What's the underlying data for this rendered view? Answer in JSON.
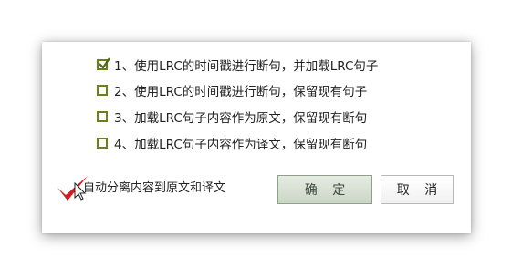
{
  "dialog": {
    "options": [
      {
        "label": "1、使用LRC的时间戳进行断句，并加载LRC句子",
        "checked": true
      },
      {
        "label": "2、使用LRC的时间戳进行断句，保留现有句子",
        "checked": false
      },
      {
        "label": "3、加载LRC句子内容作为原文，保留现有断句",
        "checked": false
      },
      {
        "label": "4、加载LRC句子内容作为译文，保留现有断句",
        "checked": false
      }
    ],
    "auto_split": {
      "label": "自动分离内容到原文和译文",
      "checked": true
    },
    "buttons": {
      "ok": "确 定",
      "cancel": "取 消"
    }
  },
  "colors": {
    "checkbox_border": "#6b7f1c",
    "tick_red": "#cc1f1f",
    "ok_button_bg": "#d6dfd2"
  }
}
